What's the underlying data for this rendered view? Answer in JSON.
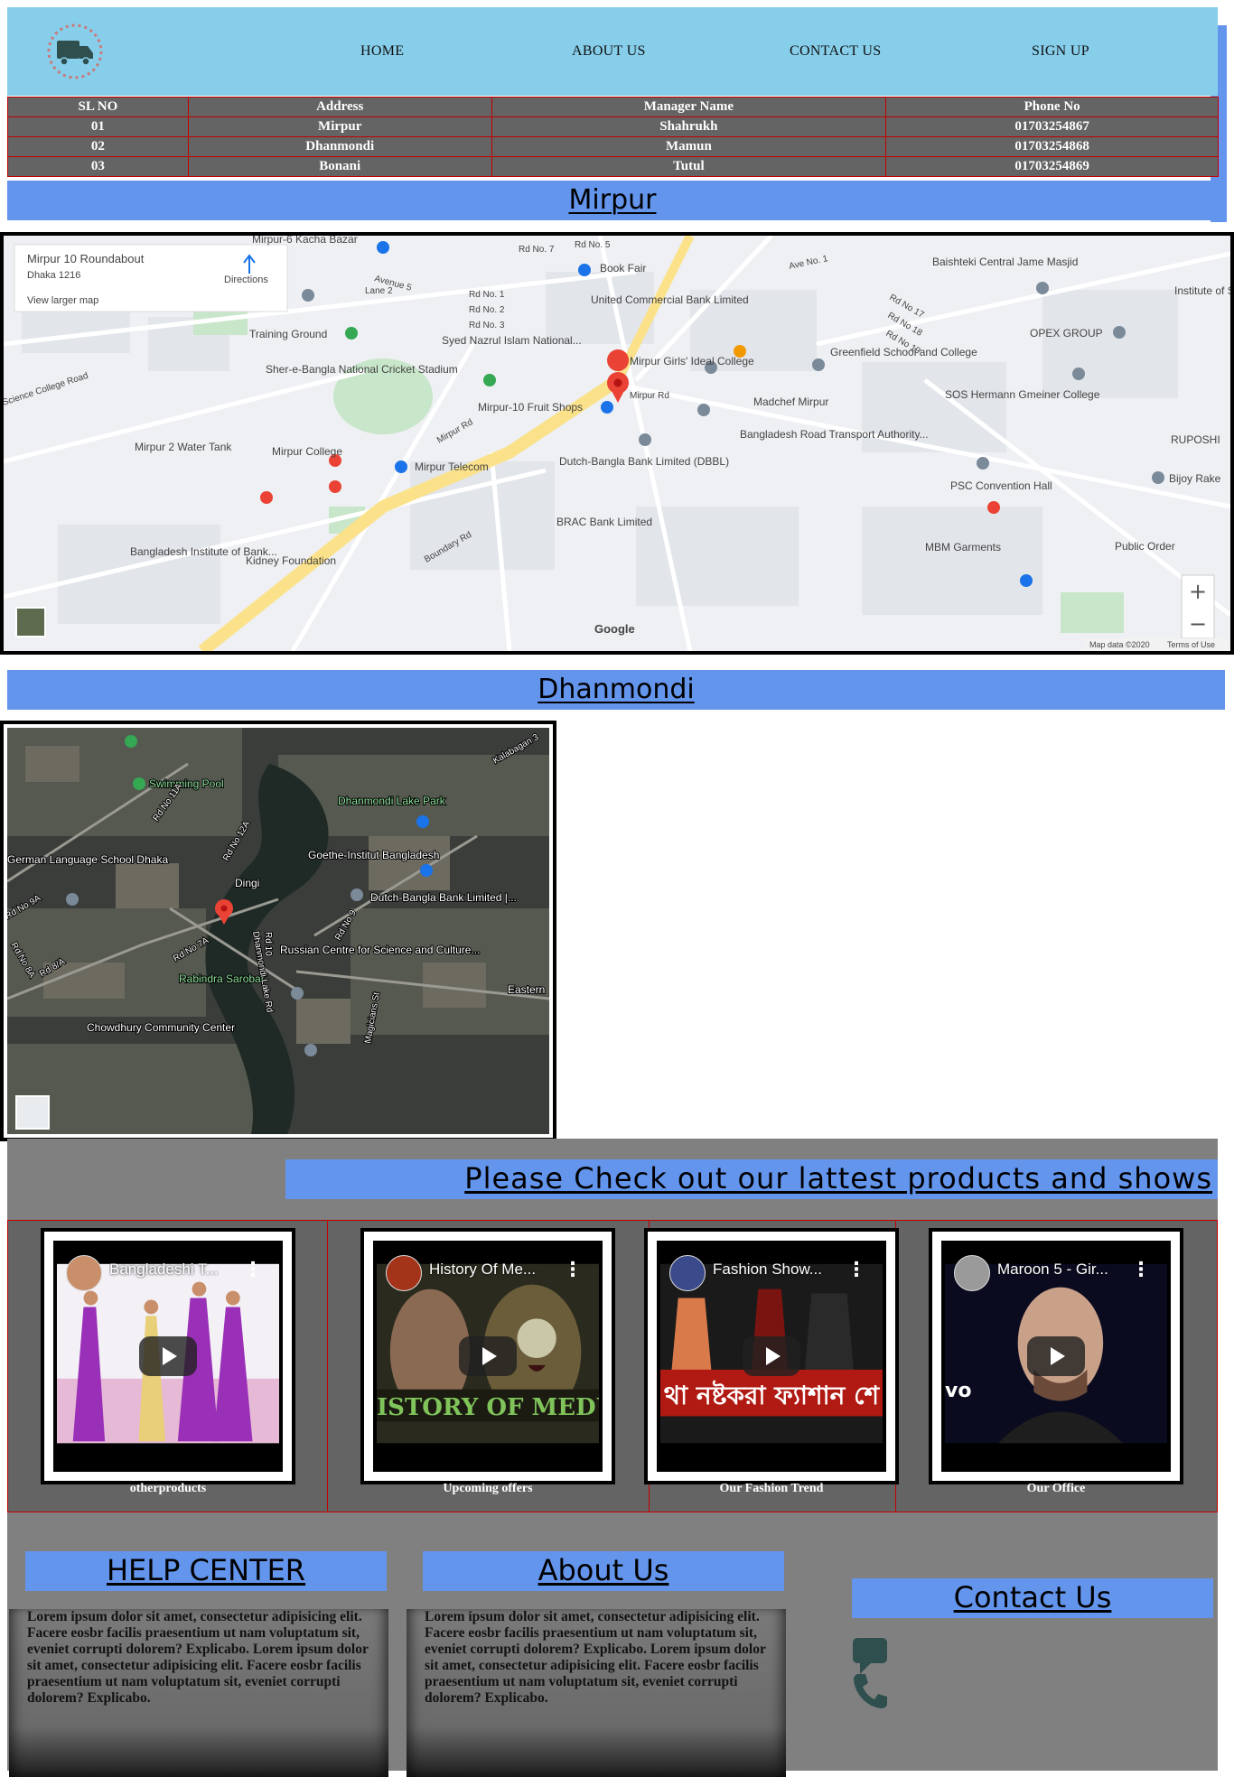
{
  "nav": {
    "logo_icon": "delivery-truck-icon",
    "items": [
      {
        "label": "HOME"
      },
      {
        "label": "ABOUT US"
      },
      {
        "label": "CONTACT US"
      },
      {
        "label": "SIGN UP"
      }
    ]
  },
  "branches_table": {
    "headers": [
      "SL NO",
      "Address",
      "Manager Name",
      "Phone No"
    ],
    "rows": [
      [
        "01",
        "Mirpur",
        "Shahrukh",
        "01703254867"
      ],
      [
        "02",
        "Dhanmondi",
        "Mamun",
        "01703254868"
      ],
      [
        "03",
        "Bonani",
        "Tutul",
        "01703254869"
      ]
    ]
  },
  "mirpur": {
    "title": "Mirpur",
    "map": {
      "place_name": "Mirpur 10 Roundabout",
      "place_address": "Dhaka 1216",
      "directions_label": "Directions",
      "larger_map_link": "View larger map",
      "attribution": "Map data ©2020",
      "terms": "Terms of Use",
      "google": "Google",
      "zoom_in": "+",
      "zoom_out": "−",
      "labels": {
        "book_fair": "Book Fair",
        "ucb": "United Commercial Bank Limited",
        "training": "Training Ground",
        "syed": "Syed Nazrul Islam National...",
        "stadium": "Sher-e-Bangla National Cricket Stadium",
        "girls": "Mirpur Girls' Ideal College",
        "greenfield": "Greenfield School and College",
        "fruit": "Mirpur-10 Fruit Shops",
        "madchef": "Madchef Mirpur",
        "sos": "SOS Hermann Gmeiner College",
        "opex": "OPEX GROUP",
        "baishteki": "Baishteki Central Jame Masjid",
        "institute": "Institute of Science Tr & Technolo",
        "water": "Mirpur 2 Water Tank",
        "college": "Mirpur College",
        "telecom": "Mirpur Telecom",
        "dbbl": "Dutch-Bangla Bank Limited (DBBL)",
        "bra": "Bangladesh Road Transport Authority...",
        "psc": "PSC Convention Hall",
        "bijoy": "Bijoy Rake",
        "ruposhi": "RUPOSHI",
        "brac": "BRAC Bank Limited",
        "mbm": "MBM Garments",
        "public": "Public Order",
        "bib": "Bangladesh Institute of Bank...",
        "kidney": "Kidney Foundation",
        "kacha": "Mirpur-6 Kacha Bazar",
        "mirpur_rd": "Mirpur Rd",
        "mirpur_rd2": "Mirpur Rd",
        "avenue5": "Avenue 5",
        "ave1": "Ave No. 1",
        "rd7": "Rd No. 7",
        "rd5": "Rd No. 5",
        "rd1": "Rd No. 1",
        "rd2": "Rd No. 2",
        "rd3": "Rd No. 3",
        "rd17": "Rd No 17",
        "rd18": "Rd No 18",
        "rd19": "Rd No 19",
        "lane2": "Lane 2",
        "college_rd": "Science College Road",
        "boundary": "Boundary Rd"
      }
    }
  },
  "dhanmondi": {
    "title": "Dhanmondi",
    "map": {
      "pin_label": "Dingi",
      "labels": {
        "pool": "Swimming Pool",
        "lake_park": "Dhanmondi Lake Park",
        "goethe": "Goethe-Institut Bangladesh",
        "german": "German Language School Dhaka",
        "dutch": "Dutch-Bangla Bank Limited |...",
        "russian": "Russian Centre for Science and Culture...",
        "rabindra": "Rabindra Sarobar",
        "chowdhury": "Chowdhury Community Center",
        "eastern": "Eastern",
        "kalabagan": "Kalabagan 3",
        "rd11a": "Rd No 11A",
        "rd12a": "Rd No 12A",
        "rd9a": "Rd No 9A",
        "rd8a": "Rd No 8A",
        "rd8a2": "Rd 8/A",
        "rd7a": "Rd No 7A",
        "rd9": "Rd No 9",
        "rd10": "Rd 10",
        "lake_rd": "Dhanmondi Lake Rd",
        "magicians": "Magicians St"
      }
    }
  },
  "products": {
    "heading": "Please Check out our lattest products and shows",
    "videos": [
      {
        "title": "Bangladeshi T...",
        "caption": "otherproducts",
        "thumb_colors": [
          "#f3f0f6",
          "#9a2fb8"
        ]
      },
      {
        "title": "History Of Me...",
        "caption": "Upcoming offers",
        "thumb_colors": [
          "#2a2a1e",
          "#6b5d3a"
        ],
        "overlay_text": "ISTORY OF MEDUSA"
      },
      {
        "title": "Fashion Show...",
        "caption": "Our Fashion Trend",
        "thumb_colors": [
          "#1a1a1a",
          "#b01a12"
        ],
        "overlay_text": "থা নষ্টকরা ফ্যাশান শে"
      },
      {
        "title": "Maroon 5 - Gir...",
        "caption": "Our Office",
        "thumb_colors": [
          "#0b0b20",
          "#c9a088"
        ],
        "overlay_text": "vo"
      }
    ]
  },
  "footer": {
    "help_center": {
      "title": "HELP CENTER",
      "text": "Lorem ipsum dolor sit amet, consectetur adipisicing elit. Facere eosbr facilis praesentium ut nam voluptatum sit, eveniet corrupti dolorem? Explicabo. Lorem ipsum dolor sit amet, consectetur adipisicing elit. Facere eosbr facilis praesentium ut nam voluptatum sit, eveniet corrupti dolorem? Explicabo."
    },
    "about_us": {
      "title": "About Us",
      "text": "Lorem ipsum dolor sit amet, consectetur adipisicing elit. Facere eosbr facilis praesentium ut nam voluptatum sit, eveniet corrupti dolorem? Explicabo. Lorem ipsum dolor sit amet, consectetur adipisicing elit. Facere eosbr facilis praesentium ut nam voluptatum sit, eveniet corrupti dolorem? Explicabo."
    },
    "contact_us": {
      "title": "Contact Us",
      "icons": [
        "chat-icon",
        "phone-icon"
      ]
    }
  },
  "colors": {
    "header_bg": "#87ceeb",
    "section_bar": "#6495ed",
    "table_bg": "#646464",
    "table_border": "#c40000",
    "products_bg": "#808080"
  }
}
